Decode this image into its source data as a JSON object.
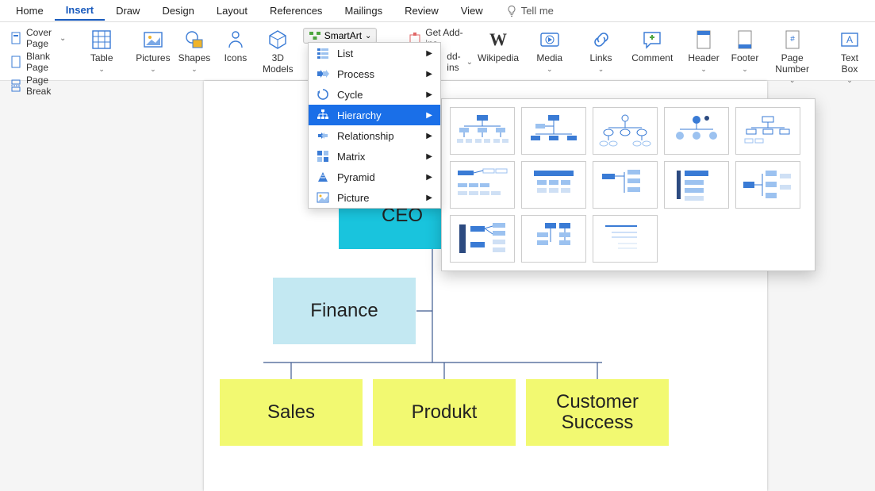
{
  "tabs": {
    "home": "Home",
    "insert": "Insert",
    "draw": "Draw",
    "design": "Design",
    "layout": "Layout",
    "references": "References",
    "mailings": "Mailings",
    "review": "Review",
    "view": "View",
    "tellme": "Tell me"
  },
  "ribbon": {
    "coverPage": "Cover Page",
    "blankPage": "Blank Page",
    "pageBreak": "Page Break",
    "table": "Table",
    "pictures": "Pictures",
    "shapes": "Shapes",
    "icons": "Icons",
    "models3d": "3D Models",
    "smartart": "SmartArt",
    "getAddins": "Get Add-ins",
    "addins": "dd-ins",
    "wikipedia": "Wikipedia",
    "media": "Media",
    "links": "Links",
    "comment": "Comment",
    "header": "Header",
    "footer": "Footer",
    "pageNumber": "Page Number",
    "textBox": "Text Box"
  },
  "smartartMenu": {
    "list": "List",
    "process": "Process",
    "cycle": "Cycle",
    "hierarchy": "Hierarchy",
    "relationship": "Relationship",
    "matrix": "Matrix",
    "pyramid": "Pyramid",
    "picture": "Picture"
  },
  "diagram": {
    "ceo": "CEO",
    "finance": "Finance",
    "sales": "Sales",
    "produkt": "Produkt",
    "customer": "Customer Success"
  }
}
